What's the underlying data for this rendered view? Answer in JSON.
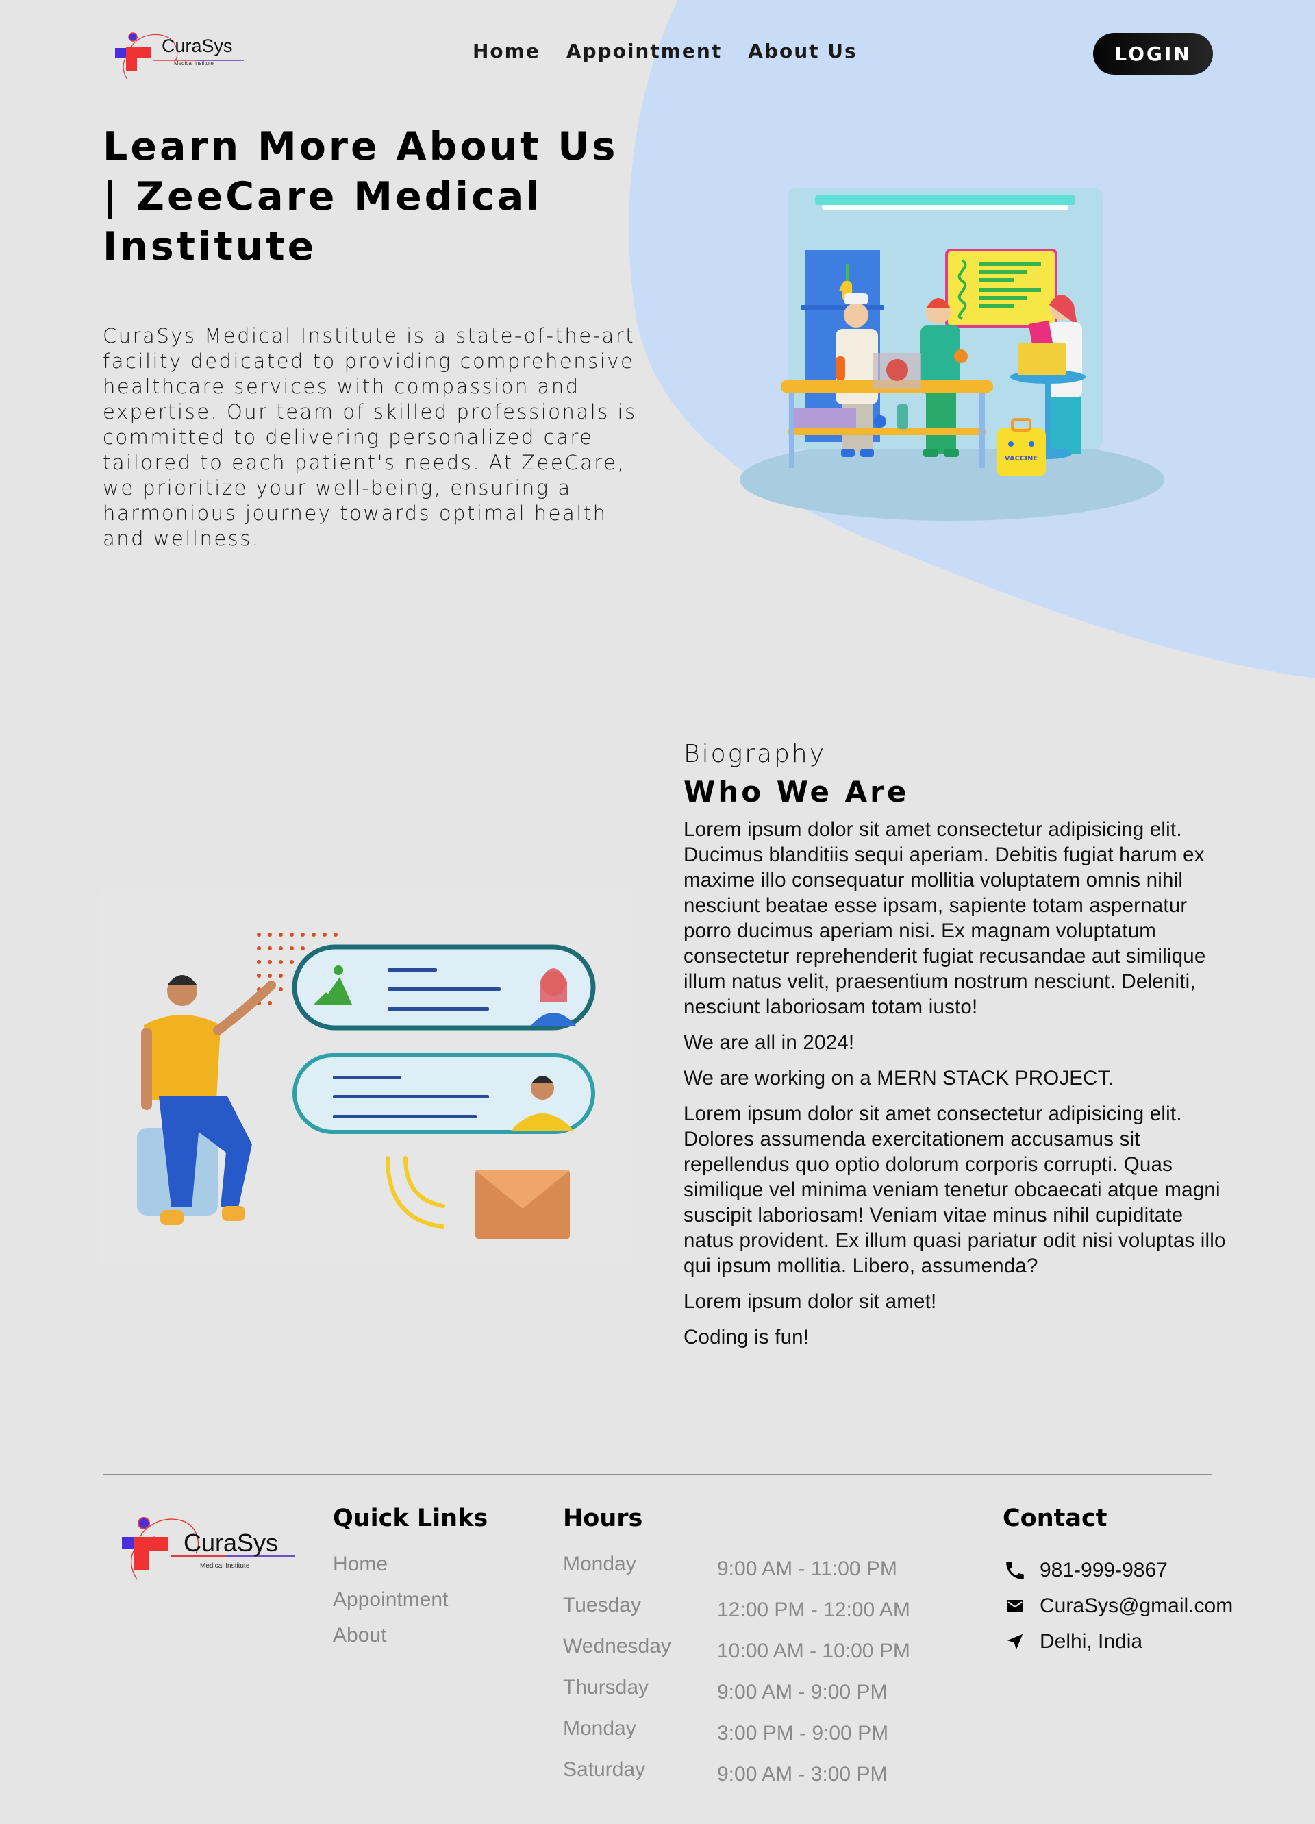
{
  "brand": {
    "name": "CuraSys",
    "tagline": "Medical Institute",
    "colors": {
      "blue": "#4b2de0",
      "red": "#f03232",
      "background": "#e5e5e5",
      "blob": "#c9dcf7"
    }
  },
  "nav": {
    "links": [
      "Home",
      "Appointment",
      "About Us"
    ],
    "login_label": "LOGIN"
  },
  "hero": {
    "title": "Learn More About Us | ZeeCare Medical Institute",
    "description": "CuraSys Medical Institute is a state-of-the-art facility dedicated to providing comprehensive healthcare services with compassion and expertise. Our team of skilled professionals is committed to delivering personalized care tailored to each patient's needs. At ZeeCare, we prioritize your well-being, ensuring a harmonious journey towards optimal health and wellness.",
    "image_alt": "3D illustration of medical lab team with vaccine kit",
    "vaccine_label": "VACCINE"
  },
  "bio": {
    "subtitle": "Biography",
    "title": "Who We Are",
    "paragraphs": [
      "Lorem ipsum dolor sit amet consectetur adipisicing elit. Ducimus blanditiis sequi aperiam. Debitis fugiat harum ex maxime illo consequatur mollitia voluptatem omnis nihil nesciunt beatae esse ipsam, sapiente totam aspernatur porro ducimus aperiam nisi. Ex magnam voluptatum consectetur reprehenderit fugiat recusandae aut similique illum natus velit, praesentium nostrum nesciunt. Deleniti, nesciunt laboriosam totam iusto!",
      "We are all in 2024!",
      "We are working on a MERN STACK PROJECT.",
      "Lorem ipsum dolor sit amet consectetur adipisicing elit. Dolores assumenda exercitationem accusamus sit repellendus quo optio dolorum corporis corrupti. Quas similique vel minima veniam tenetur obcaecati atque magni suscipit laboriosam! Veniam vitae minus nihil cupiditate natus provident. Ex illum quasi pariatur odit nisi voluptas illo qui ipsum mollitia. Libero, assumenda?",
      "Lorem ipsum dolor sit amet!",
      "Coding is fun!"
    ],
    "image_alt": "3D illustration of man presenting chat messages"
  },
  "footer": {
    "quick_links_title": "Quick Links",
    "quick_links": [
      "Home",
      "Appointment",
      "About"
    ],
    "hours_title": "Hours",
    "hours": [
      {
        "day": "Monday",
        "time": "9:00 AM - 11:00 PM"
      },
      {
        "day": "Tuesday",
        "time": "12:00 PM - 12:00 AM"
      },
      {
        "day": "Wednesday",
        "time": "10:00 AM - 10:00 PM"
      },
      {
        "day": "Thursday",
        "time": "9:00 AM - 9:00 PM"
      },
      {
        "day": "Monday",
        "time": "3:00 PM - 9:00 PM"
      },
      {
        "day": "Saturday",
        "time": "9:00 AM - 3:00 PM"
      }
    ],
    "contact_title": "Contact",
    "contact": [
      {
        "icon": "phone-icon",
        "text": "981-999-9867"
      },
      {
        "icon": "mail-icon",
        "text": "CuraSys@gmail.com"
      },
      {
        "icon": "location-arrow-icon",
        "text": "Delhi, India"
      }
    ]
  }
}
